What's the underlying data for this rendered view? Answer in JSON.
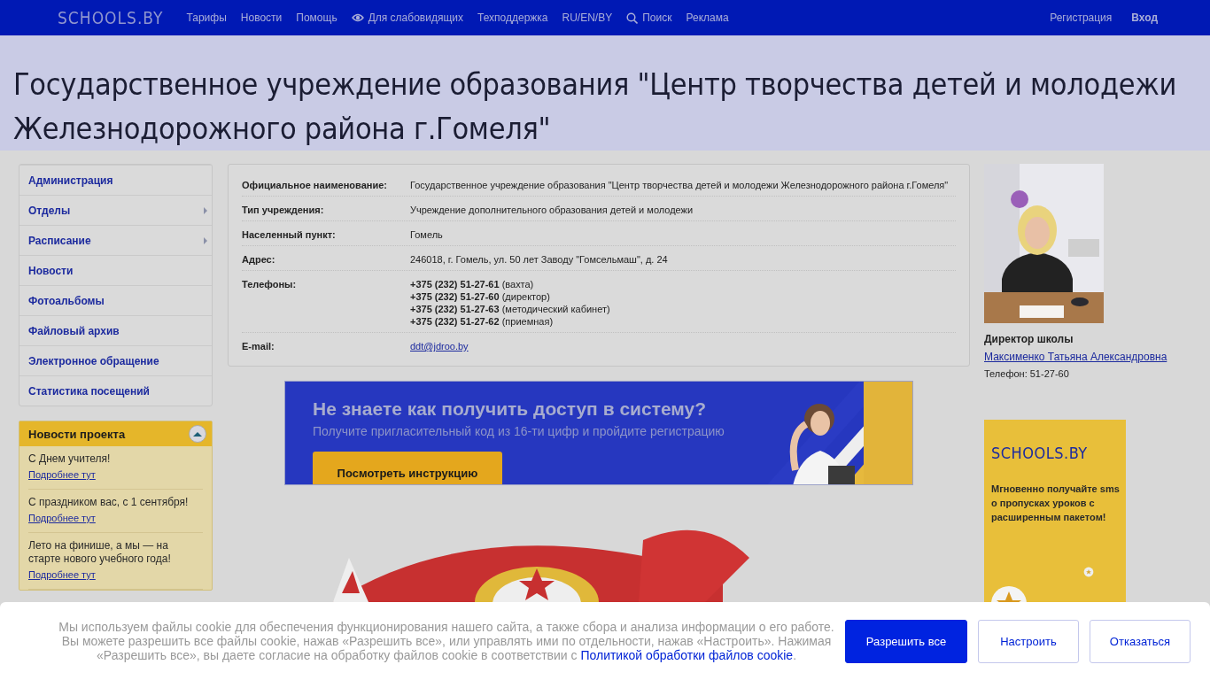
{
  "header": {
    "logo": "SCHOOLS.BY",
    "nav": [
      {
        "label": "Тарифы",
        "kind": "text"
      },
      {
        "label": "Новости",
        "kind": "text"
      },
      {
        "label": "Помощь",
        "kind": "text"
      },
      {
        "label": "Для слабовидящих",
        "kind": "eye"
      },
      {
        "label": "Техподдержка",
        "kind": "text"
      },
      {
        "label": "RU/EN/BY",
        "kind": "text"
      },
      {
        "label": "Поиск",
        "kind": "search"
      },
      {
        "label": "Реклама",
        "kind": "text"
      }
    ],
    "auth": [
      {
        "label": "Регистрация",
        "bold": false
      },
      {
        "label": "Вход",
        "bold": true
      }
    ]
  },
  "title": "Государственное учреждение образования \"Центр творчества детей и молодежи Железнодорожного района г.Гомеля\"",
  "sidebar": {
    "items": [
      {
        "label": "Администрация",
        "has_submenu": false
      },
      {
        "label": "Отделы",
        "has_submenu": true
      },
      {
        "label": "Расписание",
        "has_submenu": true
      },
      {
        "label": "Новости",
        "has_submenu": false
      },
      {
        "label": "Фотоальбомы",
        "has_submenu": false
      },
      {
        "label": "Файловый архив",
        "has_submenu": false
      },
      {
        "label": "Электронное обращение",
        "has_submenu": false
      },
      {
        "label": "Статистика посещений",
        "has_submenu": false
      }
    ]
  },
  "project_news": {
    "title": "Новости проекта",
    "expanded": true,
    "items": [
      {
        "text": "С Днем учителя!",
        "link": "Подробнее тут"
      },
      {
        "text": "С праздником вас, с 1 сентября!",
        "link": "Подробнее тут"
      },
      {
        "text": "Лето на финише, а мы — на старте нового учебного года!",
        "link": "Подробнее тут"
      }
    ]
  },
  "info": {
    "rows": [
      {
        "kind": "text",
        "label": "Официальное наименование:",
        "value": "Государственное учреждение образования \"Центр творчества детей и молодежи Железнодорожного района г.Гомеля\""
      },
      {
        "kind": "text",
        "label": "Тип учреждения:",
        "value": "Учреждение дополнительного образования детей и молодежи"
      },
      {
        "kind": "text",
        "label": "Населенный пункт:",
        "value": "Гомель"
      },
      {
        "kind": "text",
        "label": "Адрес:",
        "value": "246018, г. Гомель, ул. 50 лет Заводу \"Гомсельмаш\", д. 24"
      },
      {
        "kind": "phones",
        "label": "Телефоны:",
        "phones": [
          {
            "number": "+375 (232) 51-27-61",
            "note": "(вахта)"
          },
          {
            "number": "+375 (232) 51-27-60",
            "note": "(директор)"
          },
          {
            "number": "+375 (232) 51-27-63",
            "note": "(методический кабинет)"
          },
          {
            "number": "+375 (232) 51-27-62",
            "note": "(приемная)"
          }
        ]
      },
      {
        "kind": "email",
        "label": "E-mail:",
        "value": "ddt@jdroo.by"
      }
    ]
  },
  "director": {
    "role": "Директор школы",
    "name": "Максименко Татьяна Александровна",
    "phone": "Телефон: 51-27-60"
  },
  "banner": {
    "heading": "Не знаете как получить доступ в систему?",
    "subtitle": "Получите пригласительный код из 16-ти цифр и пройдите регистрацию",
    "button": "Посмотреть инструкцию"
  },
  "ad": {
    "logo": "SCHOOLS.BY",
    "text": "Мгновенно получайте sms о пропусках уроков с расширенным пакетом!"
  },
  "cookie": {
    "text": "Мы используем файлы cookie для обеспечения функционирования нашего сайта, а также сбора и анализа информации о его работе. Вы можете разрешить все файлы cookie, нажав «Разрешить все», или управлять ими по отдельности, нажав «Настроить». Нажимая «Разрешить все», вы даете согласие на обработку файлов cookie в соответствии с ",
    "link": "Политикой обработки файлов cookie",
    "tail": ".",
    "buttons": [
      {
        "label": "Разрешить все",
        "primary": true
      },
      {
        "label": "Настроить",
        "primary": false
      },
      {
        "label": "Отказаться",
        "primary": false
      }
    ]
  }
}
